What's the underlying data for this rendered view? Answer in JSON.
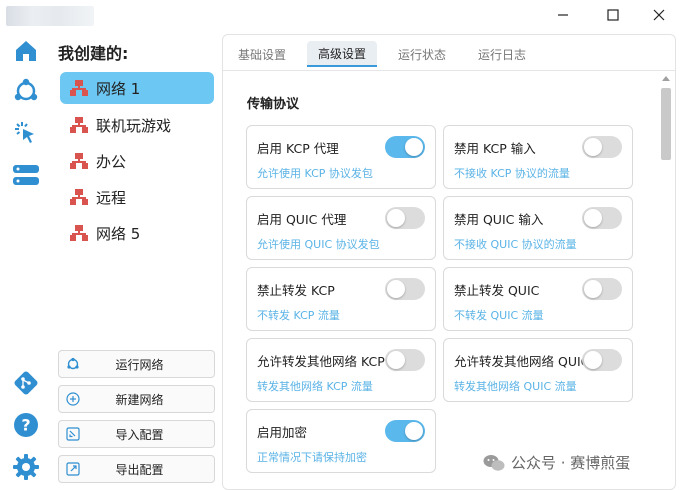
{
  "window": {
    "minimize": "—",
    "maximize": "☐",
    "close": "✕"
  },
  "network_panel": {
    "heading": "我创建的:",
    "items": [
      {
        "label": "网络 1",
        "active": true
      },
      {
        "label": "联机玩游戏",
        "active": false
      },
      {
        "label": "办公",
        "active": false
      },
      {
        "label": "远程",
        "active": false
      },
      {
        "label": "网络 5",
        "active": false
      }
    ],
    "actions": [
      {
        "label": "运行网络",
        "icon": "run-network-icon"
      },
      {
        "label": "新建网络",
        "icon": "add-icon"
      },
      {
        "label": "导入配置",
        "icon": "import-icon"
      },
      {
        "label": "导出配置",
        "icon": "export-icon"
      }
    ]
  },
  "tabs": [
    {
      "label": "基础设置",
      "active": false
    },
    {
      "label": "高级设置",
      "active": true
    },
    {
      "label": "运行状态",
      "active": false
    },
    {
      "label": "运行日志",
      "active": false
    }
  ],
  "section": {
    "title": "传输协议"
  },
  "settings": [
    {
      "title": "启用 KCP 代理",
      "desc": "允许使用 KCP 协议发包",
      "on": true
    },
    {
      "title": "禁用 KCP 输入",
      "desc": "不接收 KCP 协议的流量",
      "on": false
    },
    {
      "title": "启用 QUIC 代理",
      "desc": "允许使用 QUIC 协议发包",
      "on": false
    },
    {
      "title": "禁用 QUIC 输入",
      "desc": "不接收 QUIC 协议的流量",
      "on": false
    },
    {
      "title": "禁止转发 KCP",
      "desc": "不转发 KCP 流量",
      "on": false
    },
    {
      "title": "禁止转发 QUIC",
      "desc": "不转发 QUIC 流量",
      "on": false
    },
    {
      "title": "允许转发其他网络 KCP",
      "desc": "转发其他网络 KCP 流量",
      "on": false
    },
    {
      "title": "允许转发其他网络 QUIC",
      "desc": "转发其他网络 QUIC 流量",
      "on": false
    },
    {
      "title": "启用加密",
      "desc": "正常情况下请保持加密",
      "on": true
    }
  ],
  "watermark": {
    "text": "公众号 · 赛博煎蛋"
  },
  "colors": {
    "accent": "#5bb8ec",
    "active_item": "#6cc7f2",
    "desc_text": "#5ab3e6",
    "rail_icon": "#2f8fd1",
    "net_icon": "#d9534f"
  }
}
